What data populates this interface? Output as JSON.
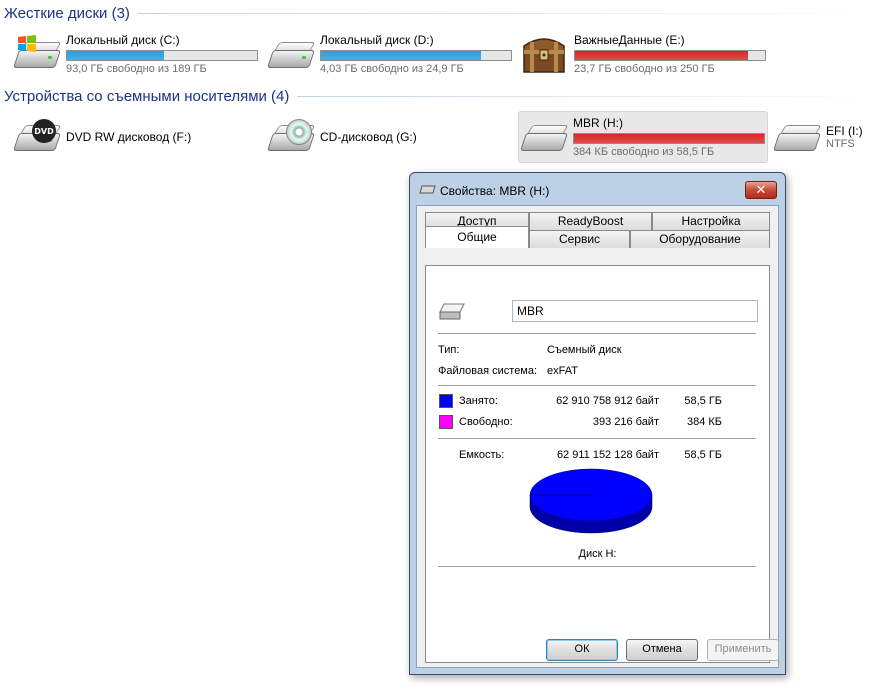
{
  "groups": {
    "hard_disks": "Жесткие диски (3)",
    "removable": "Устройства со съемными носителями (4)"
  },
  "drives": {
    "c": {
      "name": "Локальный диск (C:)",
      "free": "93,0 ГБ свободно из 189 ГБ",
      "used_fraction": 0.51,
      "bar_color": "#26a0da"
    },
    "d": {
      "name": "Локальный диск (D:)",
      "free": "4,03 ГБ свободно из 24,9 ГБ",
      "used_fraction": 0.84,
      "bar_color": "#26a0da"
    },
    "e": {
      "name": "ВажныеДанные (E:)",
      "free": "23,7 ГБ свободно из 250 ГБ",
      "used_fraction": 0.91,
      "bar_color": "#da2626"
    },
    "f": {
      "name": "DVD RW дисковод (F:)",
      "icon_label": "DVD"
    },
    "g": {
      "name": "CD-дисковод (G:)"
    },
    "h": {
      "name": "MBR (H:)",
      "free": "384 КБ свободно из 58,5 ГБ",
      "used_fraction": 0.999,
      "bar_color": "#da2626"
    },
    "i": {
      "name": "EFI (I:)",
      "fs": "NTFS"
    }
  },
  "dialog": {
    "title": "Свойства: MBR (H:)",
    "close": "✕",
    "tabs": {
      "access": "Доступ",
      "readyboost": "ReadyBoost",
      "settings": "Настройка",
      "general": "Общие",
      "service": "Сервис",
      "hardware": "Оборудование"
    },
    "volume_name": "MBR",
    "type_label": "Тип:",
    "type_value": "Съемный диск",
    "fs_label": "Файловая система:",
    "fs_value": "exFAT",
    "used_label": "Занято:",
    "used_bytes": "62 910 758 912 байт",
    "used_size": "58,5 ГБ",
    "free_label": "Свободно:",
    "free_bytes": "393 216 байт",
    "free_size": "384 КБ",
    "capacity_label": "Емкость:",
    "capacity_bytes": "62 911 152 128 байт",
    "capacity_size": "58,5 ГБ",
    "disk_label": "Диск H:",
    "used_color": "#0000ff",
    "free_color": "#ff00ff",
    "buttons": {
      "ok": "ОК",
      "cancel": "Отмена",
      "apply": "Применить"
    }
  }
}
